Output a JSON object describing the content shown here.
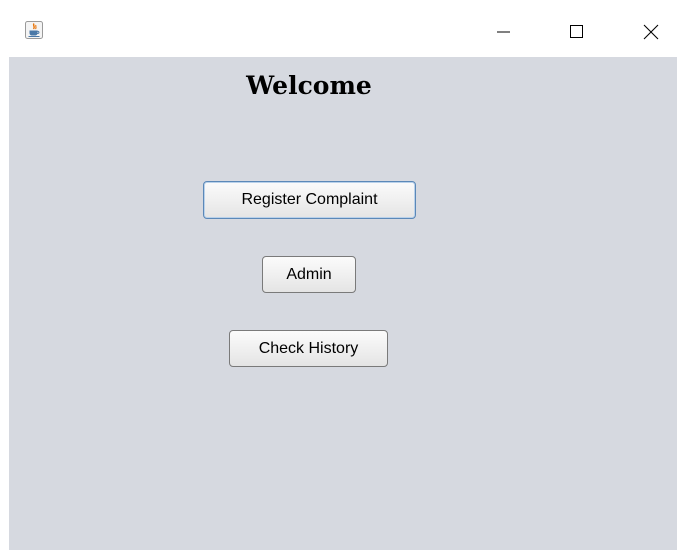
{
  "window": {
    "icon": "java-icon",
    "controls": {
      "minimize_icon": "minimize-icon",
      "maximize_icon": "maximize-icon",
      "close_icon": "close-icon"
    }
  },
  "main": {
    "title": "Welcome",
    "buttons": {
      "register": "Register Complaint",
      "admin": "Admin",
      "history": "Check History"
    }
  },
  "colors": {
    "content_background": "#d6d9e0",
    "titlebar_background": "#ffffff",
    "focus_border": "#5b88b8"
  }
}
